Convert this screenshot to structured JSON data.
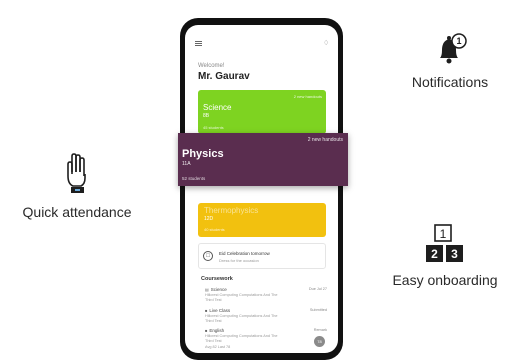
{
  "features": {
    "notifications": {
      "label": "Notifications",
      "badge": "1"
    },
    "attendance": {
      "label": "Quick attendance"
    },
    "onboarding": {
      "label": "Easy onboarding",
      "tiles": [
        "1",
        "2",
        "3"
      ]
    }
  },
  "icons": {
    "notifications": "bell-icon",
    "attendance": "hand-icon",
    "onboarding": "numbered-tiles-icon",
    "menu": "hamburger-icon",
    "app_bell": "bell-icon",
    "event": "calendar-icon"
  },
  "colors": {
    "science": "#7ed321",
    "physics": "#5a2d4f",
    "yellow_class": "#f2c10f"
  },
  "app": {
    "welcome": "Welcome!",
    "user": "Mr. Gaurav",
    "classes": [
      {
        "name": "Science",
        "section": "8B",
        "students": "45 students",
        "handouts": "2 new handouts"
      },
      {
        "name": "Physics",
        "section": "11A",
        "students": "52 students",
        "handouts": "2 new handouts"
      },
      {
        "name": "Thermophysics",
        "section": "12D",
        "students": "40 students"
      }
    ],
    "event": {
      "title": "Eid Celebration tomorrow",
      "subtitle": "Dress for the occasion"
    },
    "coursework": {
      "title": "Coursework",
      "items": [
        {
          "subject": "Science",
          "desc": "Hillcrest Computing Computations And The Third Test",
          "right": "Due Jul 27"
        },
        {
          "subject": "Live Class",
          "desc": "Hillcrest Computing Computations And The Third Test",
          "right": "Submitted"
        },
        {
          "subject": "English",
          "desc": "Hillcrest Computing Computations And The Third Test",
          "right": "Remark",
          "stats": "Avg 82   Last 78",
          "avatar": "78"
        }
      ]
    }
  }
}
